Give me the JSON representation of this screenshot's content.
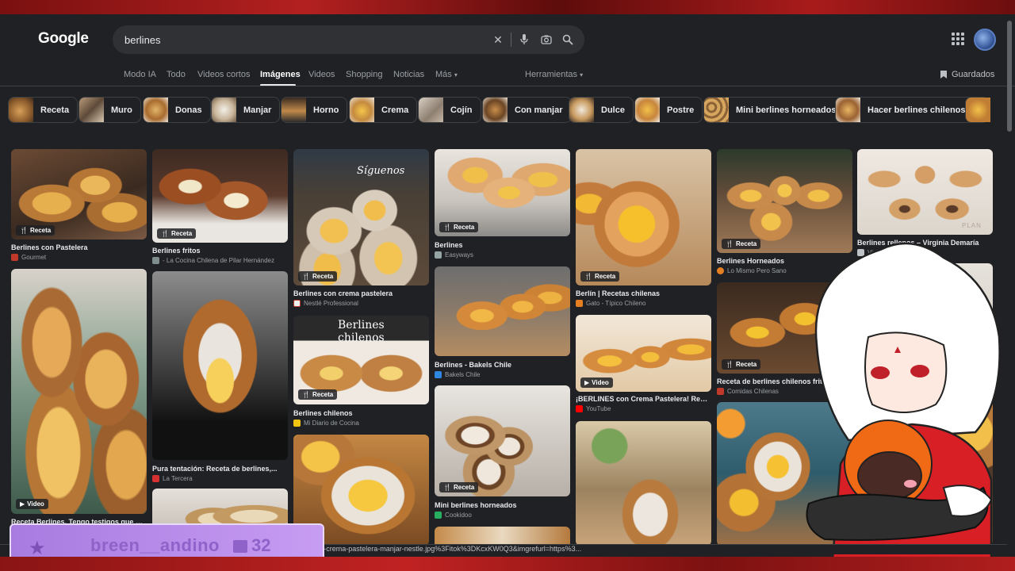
{
  "search": {
    "query": "berlines"
  },
  "logo": "Google",
  "nav": {
    "tabs": [
      "Modo IA",
      "Todo",
      "Videos cortos",
      "Imágenes",
      "Videos",
      "Shopping",
      "Noticias",
      "Más"
    ],
    "active_index": 3,
    "tools": "Herramientas",
    "saved": "Guardados"
  },
  "chips": [
    "Receta",
    "Muro",
    "Donas",
    "Manjar",
    "Horno",
    "Crema",
    "Cojín",
    "Con manjar",
    "Dulce",
    "Postre",
    "Mini berlines horneados",
    "Hacer berlines chilenos"
  ],
  "results": [
    {
      "title": "Berlines con Pastelera",
      "source": "Gourmet",
      "badge": "Receta"
    },
    {
      "title": "Receta Berlines, Tengo testigos que dice...",
      "source": "",
      "badge": "Video"
    },
    {
      "title": "Berlines fritos",
      "source": "- La Cocina Chilena de Pilar Hernández",
      "badge": "Receta"
    },
    {
      "title": "Pura tentación: Receta de berlines,...",
      "source": "La Tercera",
      "badge": ""
    },
    {
      "title": "Berlines con crema pastelera",
      "source": "Nestlé Professional",
      "badge": "Receta"
    },
    {
      "title": "Berlines chilenos",
      "source": "Mi Diario de Cocina",
      "badge": "Receta"
    },
    {
      "title": "Berlines",
      "source": "Easyways",
      "badge": "Receta"
    },
    {
      "title": "Berlines - Bakels Chile",
      "source": "Bakels Chile",
      "badge": ""
    },
    {
      "title": "Mini berlines horneados",
      "source": "Cookidoo",
      "badge": "Receta"
    },
    {
      "title": "Berlín | Recetas chilenas",
      "source": "Gato - Típico Chileno",
      "badge": "Receta"
    },
    {
      "title": "¡BERLINES con Crema Pastelera! Receta...",
      "source": "YouTube",
      "badge": "Video"
    },
    {
      "title": "Berlines Horneados",
      "source": "Lo Mismo Pero Sano",
      "badge": "Receta"
    },
    {
      "title": "Receta de berlines chilenos frito",
      "source": "Comidas Chilenas",
      "badge": "Receta"
    },
    {
      "title": "Berlines rellenos – Virginia Demaría",
      "source": "Virginia Demaría",
      "badge": ""
    }
  ],
  "image_texts": {
    "nestle_sign": "Síguenos",
    "berlines_chilenos": "Berlines chilenos",
    "plan_watermark": "PLAN"
  },
  "status_url": "https://...tes%2Fdefault%2Ffiles%2Fstyles%2Fnp_recipe_detail%2Fpublic%2F2025-06%2Fberlines-crema-pastelera-manjar-nestle.jpg%3Fitok%3DKcxKW0Q3&imgrefurl=https%3...",
  "status_url_tail": "...r%2Frecetas...",
  "subscriber": {
    "name": "breen__andino",
    "months": "32"
  },
  "colors": {
    "page": "#202124",
    "search_bg": "#303134",
    "text": "#e8eaed",
    "muted": "#9aa0a6",
    "sub_panel": "#b48ae8"
  }
}
